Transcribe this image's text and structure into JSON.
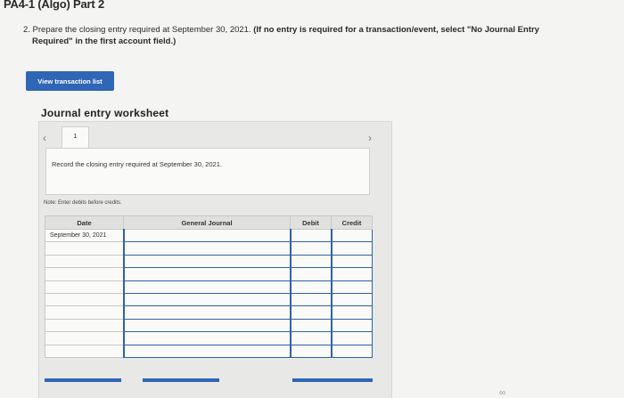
{
  "header": {
    "title": "PA4-1 (Algo) Part 2"
  },
  "instructions": {
    "lead": "2. Prepare the closing entry required at September 30, 2021. ",
    "bold_first": "(If no entry is required for a transaction/event, select \"No Journal Entry",
    "bold_second": "Required\" in the first account field.)"
  },
  "buttons": {
    "view_transactions": "View transaction list"
  },
  "worksheet": {
    "title": "Journal entry worksheet",
    "prev_icon": "chevron-left-icon",
    "next_icon": "chevron-right-icon",
    "current_tab": "1",
    "prompt": "Record the closing entry required at September 30, 2021.",
    "note": "Note: Enter debits before credits."
  },
  "journal_table": {
    "headers": {
      "date": "Date",
      "account": "General Journal",
      "debit": "Debit",
      "credit": "Credit"
    },
    "rows": [
      {
        "date": "September 30, 2021",
        "account": "",
        "debit": "",
        "credit": ""
      },
      {
        "date": "",
        "account": "",
        "debit": "",
        "credit": ""
      },
      {
        "date": "",
        "account": "",
        "debit": "",
        "credit": ""
      },
      {
        "date": "",
        "account": "",
        "debit": "",
        "credit": ""
      },
      {
        "date": "",
        "account": "",
        "debit": "",
        "credit": ""
      },
      {
        "date": "",
        "account": "",
        "debit": "",
        "credit": ""
      },
      {
        "date": "",
        "account": "",
        "debit": "",
        "credit": ""
      },
      {
        "date": "",
        "account": "",
        "debit": "",
        "credit": ""
      },
      {
        "date": "",
        "account": "",
        "debit": "",
        "credit": ""
      },
      {
        "date": "",
        "account": "",
        "debit": "",
        "credit": ""
      }
    ]
  },
  "footer": {
    "link_icon": "link-icon"
  },
  "colors": {
    "accent": "#2f66b6",
    "panel": "#e8e8e6",
    "input_border": "#2f62a8"
  }
}
